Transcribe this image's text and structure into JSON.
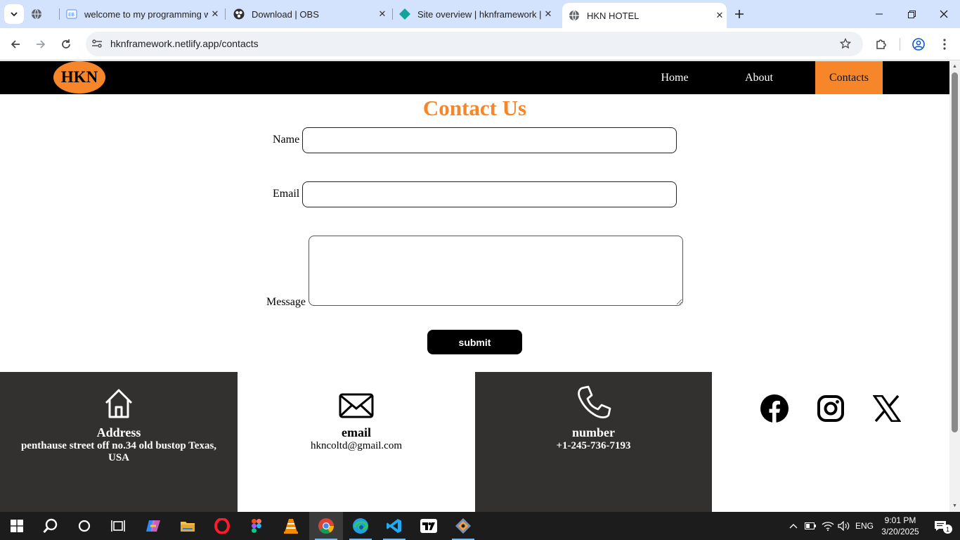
{
  "browser": {
    "tabs": [
      {
        "title": "welcome to my programming w",
        "icon": "eb-page-icon"
      },
      {
        "title": "Download | OBS",
        "icon": "obs-icon"
      },
      {
        "title": "Site overview | hknframework | N",
        "icon": "netlify-icon"
      },
      {
        "title": "HKN HOTEL",
        "icon": "globe-icon",
        "active": true
      }
    ],
    "url": "hknframework.netlify.app/contacts"
  },
  "site": {
    "logo": "HKN",
    "nav": [
      {
        "label": "Home"
      },
      {
        "label": "About"
      },
      {
        "label": "Contacts",
        "active": true
      }
    ],
    "accent_color": "#f7862b",
    "form": {
      "title": "Contact Us",
      "name_label": "Name",
      "name_value": "",
      "email_label": "Email",
      "email_value": "",
      "message_label": "Message",
      "message_value": "",
      "submit_label": "submit"
    },
    "footer": {
      "address": {
        "heading": "Address",
        "value": "penthause street off no.34 old bustop Texas, USA",
        "icon": "house-icon"
      },
      "email": {
        "heading": "email",
        "value": "hkncoltd@gmail.com",
        "icon": "envelope-icon"
      },
      "number": {
        "heading": "number",
        "value": "+1-245-736-7193",
        "icon": "phone-icon"
      },
      "social": [
        "facebook-icon",
        "instagram-icon",
        "x-icon"
      ]
    }
  },
  "taskbar": {
    "language": "ENG",
    "time": "9:01 PM",
    "date": "3/20/2025",
    "notifications": "1"
  }
}
